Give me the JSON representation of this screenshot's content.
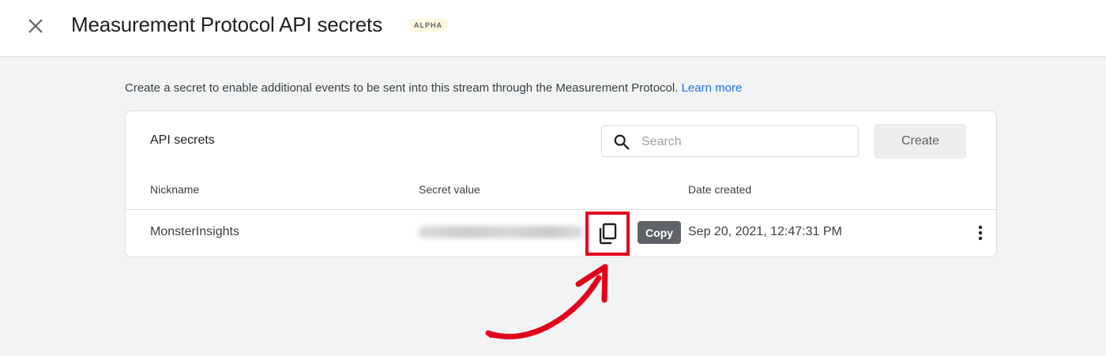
{
  "header": {
    "title": "Measurement Protocol API secrets",
    "badge": "ALPHA",
    "close_icon": "close-icon"
  },
  "intro": {
    "text": "Create a secret to enable additional events to be sent into this stream through the Measurement Protocol.",
    "link": "Learn more"
  },
  "card": {
    "title": "API secrets",
    "search": {
      "placeholder": "Search",
      "value": "",
      "icon": "search-icon"
    },
    "create_label": "Create",
    "columns": [
      "Nickname",
      "Secret value",
      "Date created"
    ],
    "rows": [
      {
        "nickname": "MonsterInsights",
        "secret_value": "",
        "date_created": "Sep 20, 2021, 12:47:31 PM",
        "copy_tooltip": "Copy",
        "copy_icon": "copy-icon",
        "menu_icon": "more-vert-icon"
      }
    ]
  },
  "colors": {
    "highlight": "#e3001b",
    "link": "#1a73e8",
    "background": "#f1f3f4"
  }
}
